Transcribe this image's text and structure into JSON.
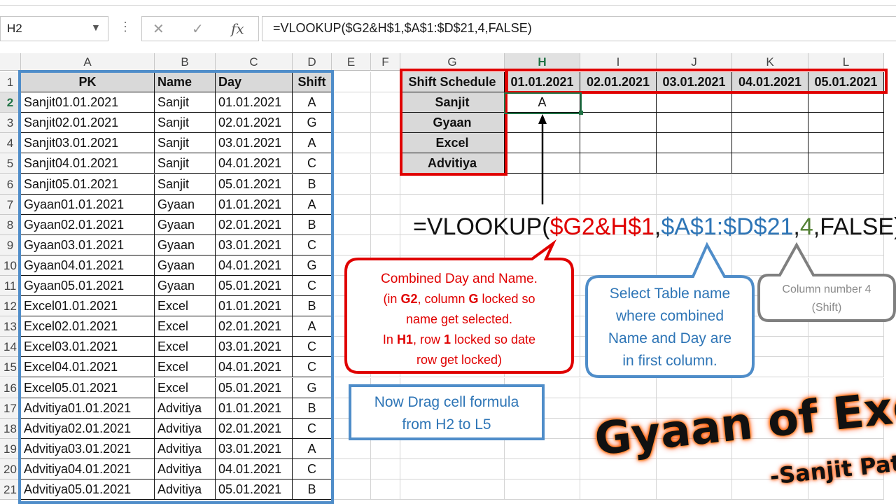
{
  "formula_bar": {
    "name_box": "H2",
    "cancel_icon": "cross-icon",
    "enter_icon": "check-icon",
    "fx_icon": "fx",
    "formula": "=VLOOKUP($G2&H$1,$A$1:$D$21,4,FALSE)"
  },
  "columns": [
    "A",
    "B",
    "C",
    "D",
    "E",
    "F",
    "G",
    "H",
    "I",
    "J",
    "K",
    "L"
  ],
  "rows": [
    "1",
    "2",
    "3",
    "4",
    "5",
    "6",
    "7",
    "8",
    "9",
    "10",
    "11",
    "12",
    "13",
    "14",
    "15",
    "16",
    "17",
    "18",
    "19",
    "20",
    "21"
  ],
  "table": {
    "headers": [
      "PK",
      "Name",
      "Day",
      "Shift"
    ],
    "rows": [
      [
        "Sanjit01.01.2021",
        "Sanjit",
        "01.01.2021",
        "A"
      ],
      [
        "Sanjit02.01.2021",
        "Sanjit",
        "02.01.2021",
        "G"
      ],
      [
        "Sanjit03.01.2021",
        "Sanjit",
        "03.01.2021",
        "A"
      ],
      [
        "Sanjit04.01.2021",
        "Sanjit",
        "04.01.2021",
        "C"
      ],
      [
        "Sanjit05.01.2021",
        "Sanjit",
        "05.01.2021",
        "B"
      ],
      [
        "Gyaan01.01.2021",
        "Gyaan",
        "01.01.2021",
        "A"
      ],
      [
        "Gyaan02.01.2021",
        "Gyaan",
        "02.01.2021",
        "B"
      ],
      [
        "Gyaan03.01.2021",
        "Gyaan",
        "03.01.2021",
        "C"
      ],
      [
        "Gyaan04.01.2021",
        "Gyaan",
        "04.01.2021",
        "G"
      ],
      [
        "Gyaan05.01.2021",
        "Gyaan",
        "05.01.2021",
        "C"
      ],
      [
        "Excel01.01.2021",
        "Excel",
        "01.01.2021",
        "B"
      ],
      [
        "Excel02.01.2021",
        "Excel",
        "02.01.2021",
        "A"
      ],
      [
        "Excel03.01.2021",
        "Excel",
        "03.01.2021",
        "C"
      ],
      [
        "Excel04.01.2021",
        "Excel",
        "04.01.2021",
        "C"
      ],
      [
        "Excel05.01.2021",
        "Excel",
        "05.01.2021",
        "G"
      ],
      [
        "Advitiya01.01.2021",
        "Advitiya",
        "01.01.2021",
        "B"
      ],
      [
        "Advitiya02.01.2021",
        "Advitiya",
        "02.01.2021",
        "C"
      ],
      [
        "Advitiya03.01.2021",
        "Advitiya",
        "03.01.2021",
        "A"
      ],
      [
        "Advitiya04.01.2021",
        "Advitiya",
        "04.01.2021",
        "C"
      ],
      [
        "Advitiya05.01.2021",
        "Advitiya",
        "05.01.2021",
        "B"
      ]
    ]
  },
  "schedule": {
    "title": "Shift Schedule",
    "dates": [
      "01.01.2021",
      "02.01.2021",
      "03.01.2021",
      "04.01.2021",
      "05.01.2021"
    ],
    "names": [
      "Sanjit",
      "Gyaan",
      "Excel",
      "Advitiya"
    ],
    "h2_value": "A"
  },
  "formula_display": {
    "prefix": "=VLOOKUP(",
    "lookup_value": "$G2&H$1",
    "comma1": ",",
    "table_array": "$A$1:$D$21",
    "comma2": ",",
    "col_index": "4",
    "suffix": ",FALSE)"
  },
  "callouts": {
    "combined": {
      "line1": "Combined Day and Name.",
      "line2_a": "(in ",
      "line2_b": "G2",
      "line2_c": ", column ",
      "line2_d": "G",
      "line2_e": " locked so",
      "line3": "name get selected.",
      "line4_a": "In ",
      "line4_b": "H1",
      "line4_c": ", row ",
      "line4_d": "1",
      "line4_e": " locked so date",
      "line5": "row get locked)"
    },
    "table_name": [
      "Select Table name",
      "where combined",
      "Name and Day are",
      "in first column."
    ],
    "column_number": [
      "Column number 4",
      "(Shift)"
    ],
    "drag": [
      "Now Drag cell formula",
      "from H2 to L5"
    ]
  },
  "logo": {
    "main": "Gyaan of Excel",
    "sub": "-Sanjit Patel"
  },
  "colors": {
    "red": "#e00000",
    "blue": "#4f8dc9",
    "gray": "#777777",
    "green": "#217346",
    "formula_blue": "#2e75b6",
    "formula_green": "#548235"
  }
}
